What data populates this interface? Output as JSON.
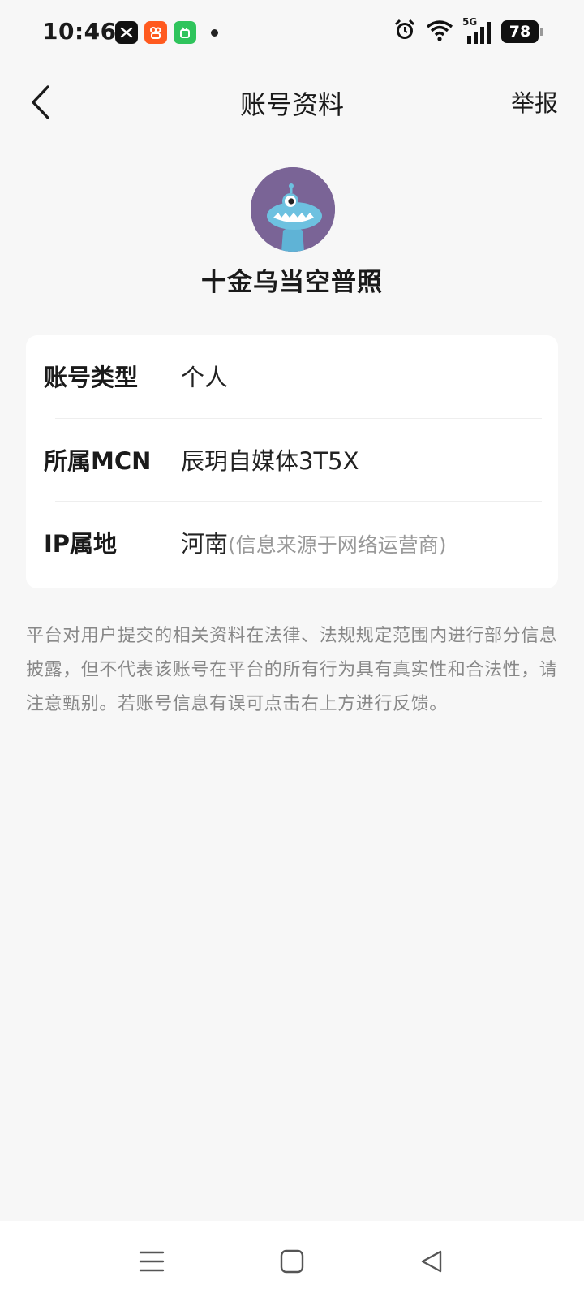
{
  "status_bar": {
    "time": "10:46",
    "network": "5G",
    "battery": "78",
    "app_icons": [
      "capcut-icon",
      "kuaishou-icon",
      "android-app-icon"
    ]
  },
  "nav": {
    "title": "账号资料",
    "report_label": "举报",
    "back_icon": "chevron-left-icon"
  },
  "profile": {
    "name": "十金乌当空普照",
    "avatar_color": "#7a6496"
  },
  "info": {
    "rows": [
      {
        "label": "账号类型",
        "value": "个人",
        "note": ""
      },
      {
        "label": "所属MCN",
        "value": "辰玥自媒体3T5X",
        "note": ""
      },
      {
        "label": "IP属地",
        "value": "河南",
        "note": "(信息来源于网络运营商)"
      }
    ]
  },
  "disclaimer": "平台对用户提交的相关资料在法律、法规规定范围内进行部分信息披露，但不代表该账号在平台的所有行为具有真实性和合法性，请注意甄别。若账号信息有误可点击右上方进行反馈。",
  "system_nav": {
    "icons": [
      "menu-icon",
      "home-icon",
      "back-triangle-icon"
    ]
  }
}
